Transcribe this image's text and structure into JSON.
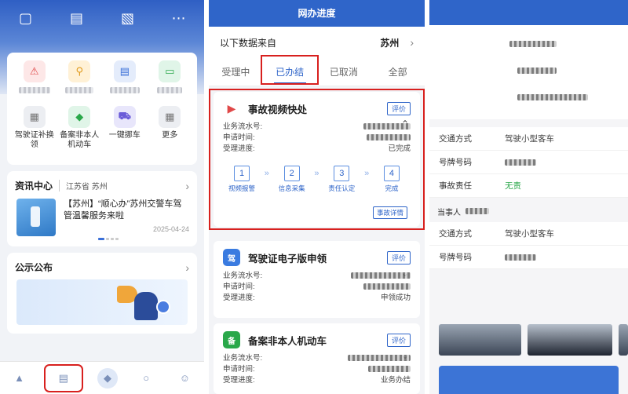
{
  "home": {
    "services_row1": [
      "",
      "",
      "",
      ""
    ],
    "services_row2": [
      {
        "label": "驾驶证补换领",
        "icon": "license-icon"
      },
      {
        "label": "备案非本人机动车",
        "icon": "shield-icon"
      },
      {
        "label": "一键挪车",
        "icon": "tow-truck-icon"
      },
      {
        "label": "更多",
        "icon": "more-grid-icon"
      }
    ],
    "news": {
      "title": "资讯中心",
      "location": "江苏省 苏州",
      "headline": "【苏州】“顺心办”苏州交警车驾管温馨服务来啦",
      "date": "2025-04-24"
    },
    "notice_title": "公示公布"
  },
  "progress": {
    "bar_title": "网办进度",
    "source_label": "以下数据来自",
    "source_city": "苏州",
    "tabs": [
      "受理中",
      "已办结",
      "已取消",
      "全部"
    ],
    "active_tab": "已办结",
    "records": [
      {
        "title": "事故视频快处",
        "eval": "评价",
        "k1": "业务流水号:",
        "k2": "申请时间:",
        "k3": "受理进度:",
        "status": "已完成",
        "steps": [
          {
            "n": "1",
            "label": "视频报警"
          },
          {
            "n": "2",
            "label": "信息采集"
          },
          {
            "n": "3",
            "label": "责任认定"
          },
          {
            "n": "4",
            "label": "完成"
          }
        ],
        "detail_btn": "事故详情"
      },
      {
        "title": "驾驶证电子版申领",
        "eval": "评价",
        "k1": "业务流水号:",
        "k2": "申请时间:",
        "k3": "受理进度:",
        "status": "申领成功",
        "icon_text": "驾"
      },
      {
        "title": "备案非本人机动车",
        "eval": "评价",
        "k1": "业务流水号:",
        "k2": "申请时间:",
        "k3": "受理进度:",
        "status": "业务办结",
        "icon_text": "备"
      }
    ]
  },
  "detail": {
    "rows_a": [
      {
        "k": "交通方式",
        "v": "驾驶小型客车"
      },
      {
        "k": "号牌号码",
        "v": ""
      },
      {
        "k": "事故责任",
        "v": "无责"
      }
    ],
    "party_label": "当事人",
    "rows_b": [
      {
        "k": "交通方式",
        "v": "驾驶小型客车"
      },
      {
        "k": "号牌号码",
        "v": ""
      }
    ]
  },
  "colors": {
    "brand": "#2f65c9",
    "highlight": "#d8201e",
    "success": "#2aa84a"
  }
}
